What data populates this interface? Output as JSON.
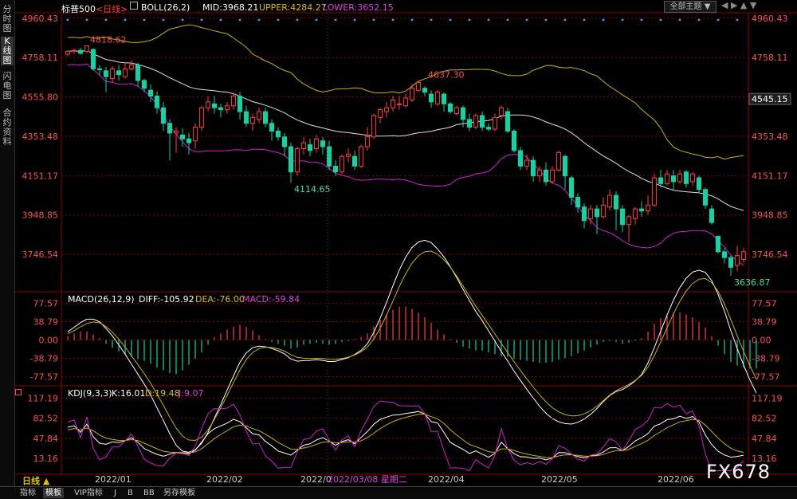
{
  "side_tabs": [
    "分时图",
    "K线图",
    "闪电图",
    "合约资料"
  ],
  "header": {
    "symbol": "标普500",
    "period": "<日线>",
    "boll_label": "BOLL(26,2)",
    "mid": "MID:3968.21",
    "upper": "UPPER:4284.27",
    "lower": "LOWER:3652.15",
    "theme_button": "全部主题 ▼"
  },
  "macd_header": {
    "label": "MACD(26,12,9)",
    "diff": "DIFF:-105.92",
    "dea": "DEA:-76.00",
    "macd": "MACD:-59.84"
  },
  "kdj_header": {
    "label": "KDJ(9,3,3)",
    "k": "K:16.01",
    "d": "D:19.48",
    "j": "J:9.07"
  },
  "bottom": {
    "period_label": "日线 ▲",
    "tabs": [
      "指标",
      "模板",
      "VIP指标",
      "J",
      "B",
      "BB",
      "另存模板"
    ],
    "active_tab": 1,
    "x_labels": [
      "2022/01",
      "2022/02",
      "2022/0",
      "2022/03/08 星期二",
      "2022/04",
      "2022/05",
      "2022/06"
    ]
  },
  "watermark": "FX678",
  "colors": {
    "up": "#ff4040",
    "down": "#18d0a0",
    "mid": "#e0e0e0",
    "upper": "#c8b400",
    "lower": "#d020d0",
    "grid": "#8a0000"
  },
  "chart_data": [
    {
      "type": "candlestick",
      "title": "标普500 <日线> BOLL(26,2)",
      "y_ticks": [
        4960.43,
        4758.11,
        4555.8,
        4353.48,
        4151.17,
        3948.85,
        3746.54
      ],
      "ylim": [
        3620,
        4980
      ],
      "last_price_tag": 4545.15,
      "annotations": [
        {
          "label": "4818.62",
          "value": 4818.62,
          "index": 3
        },
        {
          "label": "4637.30",
          "value": 4637.3,
          "index": 56
        },
        {
          "label": "4114.65",
          "value": 4114.65,
          "index": 35
        },
        {
          "label": "3636.87",
          "value": 3636.87,
          "index": 104
        }
      ],
      "candles": [
        [
          4775,
          4790,
          4765,
          4796
        ],
        [
          4792,
          4795,
          4778,
          4805
        ],
        [
          4795,
          4780,
          4772,
          4808
        ],
        [
          4790,
          4818,
          4780,
          4818
        ],
        [
          4800,
          4700,
          4690,
          4805
        ],
        [
          4700,
          4695,
          4670,
          4720
        ],
        [
          4690,
          4660,
          4580,
          4710
        ],
        [
          4650,
          4700,
          4630,
          4715
        ],
        [
          4690,
          4670,
          4640,
          4720
        ],
        [
          4660,
          4700,
          4650,
          4735
        ],
        [
          4700,
          4720,
          4690,
          4745
        ],
        [
          4720,
          4640,
          4610,
          4730
        ],
        [
          4640,
          4600,
          4580,
          4650
        ],
        [
          4590,
          4560,
          4530,
          4620
        ],
        [
          4560,
          4500,
          4470,
          4585
        ],
        [
          4500,
          4420,
          4380,
          4530
        ],
        [
          4420,
          4370,
          4230,
          4440
        ],
        [
          4370,
          4380,
          4270,
          4400
        ],
        [
          4360,
          4340,
          4300,
          4395
        ],
        [
          4340,
          4320,
          4260,
          4370
        ],
        [
          4330,
          4400,
          4290,
          4420
        ],
        [
          4400,
          4500,
          4380,
          4510
        ],
        [
          4500,
          4530,
          4480,
          4560
        ],
        [
          4520,
          4500,
          4470,
          4560
        ],
        [
          4500,
          4490,
          4450,
          4520
        ],
        [
          4490,
          4510,
          4470,
          4530
        ],
        [
          4510,
          4560,
          4490,
          4580
        ],
        [
          4560,
          4480,
          4440,
          4580
        ],
        [
          4480,
          4420,
          4400,
          4510
        ],
        [
          4420,
          4450,
          4380,
          4470
        ],
        [
          4440,
          4480,
          4420,
          4500
        ],
        [
          4480,
          4420,
          4400,
          4500
        ],
        [
          4420,
          4380,
          4330,
          4440
        ],
        [
          4380,
          4350,
          4330,
          4400
        ],
        [
          4350,
          4300,
          4250,
          4370
        ],
        [
          4300,
          4170,
          4114.65,
          4320
        ],
        [
          4170,
          4290,
          4150,
          4300
        ],
        [
          4290,
          4320,
          4260,
          4350
        ],
        [
          4310,
          4280,
          4250,
          4340
        ],
        [
          4290,
          4340,
          4270,
          4360
        ],
        [
          4330,
          4300,
          4260,
          4350
        ],
        [
          4300,
          4200,
          4180,
          4330
        ],
        [
          4200,
          4170,
          4150,
          4230
        ],
        [
          4170,
          4250,
          4160,
          4260
        ],
        [
          4250,
          4260,
          4220,
          4290
        ],
        [
          4250,
          4200,
          4180,
          4280
        ],
        [
          4200,
          4300,
          4190,
          4310
        ],
        [
          4300,
          4350,
          4280,
          4400
        ],
        [
          4350,
          4460,
          4340,
          4470
        ],
        [
          4450,
          4490,
          4420,
          4500
        ],
        [
          4480,
          4500,
          4450,
          4530
        ],
        [
          4500,
          4540,
          4480,
          4560
        ],
        [
          4520,
          4520,
          4490,
          4560
        ],
        [
          4510,
          4550,
          4500,
          4570
        ],
        [
          4540,
          4600,
          4530,
          4620
        ],
        [
          4590,
          4630,
          4580,
          4637.3
        ],
        [
          4600,
          4580,
          4560,
          4610
        ],
        [
          4570,
          4530,
          4500,
          4590
        ],
        [
          4520,
          4580,
          4510,
          4590
        ],
        [
          4570,
          4520,
          4480,
          4580
        ],
        [
          4520,
          4480,
          4470,
          4530
        ],
        [
          4470,
          4500,
          4460,
          4510
        ],
        [
          4500,
          4440,
          4400,
          4510
        ],
        [
          4440,
          4400,
          4380,
          4470
        ],
        [
          4400,
          4460,
          4390,
          4470
        ],
        [
          4460,
          4400,
          4380,
          4480
        ],
        [
          4400,
          4390,
          4380,
          4420
        ],
        [
          4390,
          4450,
          4380,
          4470
        ],
        [
          4460,
          4500,
          4440,
          4510
        ],
        [
          4480,
          4380,
          4370,
          4500
        ],
        [
          4380,
          4280,
          4270,
          4390
        ],
        [
          4280,
          4200,
          4180,
          4300
        ],
        [
          4200,
          4230,
          4180,
          4260
        ],
        [
          4230,
          4150,
          4120,
          4250
        ],
        [
          4150,
          4180,
          4120,
          4200
        ],
        [
          4180,
          4120,
          4100,
          4220
        ],
        [
          4120,
          4180,
          4110,
          4200
        ],
        [
          4180,
          4270,
          4170,
          4280
        ],
        [
          4250,
          4150,
          4080,
          4260
        ],
        [
          4140,
          4040,
          4000,
          4150
        ],
        [
          4040,
          3990,
          3960,
          4060
        ],
        [
          3990,
          3920,
          3880,
          4010
        ],
        [
          3930,
          3980,
          3900,
          4000
        ],
        [
          3980,
          3940,
          3850,
          4000
        ],
        [
          3940,
          4000,
          3930,
          4040
        ],
        [
          3990,
          4050,
          3970,
          4080
        ],
        [
          4050,
          3980,
          3870,
          4070
        ],
        [
          3980,
          3900,
          3860,
          4000
        ],
        [
          3900,
          3940,
          3810,
          3950
        ],
        [
          3930,
          3980,
          3900,
          3990
        ],
        [
          3980,
          3970,
          3940,
          4020
        ],
        [
          3970,
          4000,
          3950,
          4050
        ],
        [
          4000,
          4140,
          3990,
          4160
        ],
        [
          4140,
          4110,
          4090,
          4180
        ],
        [
          4110,
          4160,
          4100,
          4180
        ],
        [
          4150,
          4120,
          4080,
          4180
        ],
        [
          4120,
          4160,
          4110,
          4180
        ],
        [
          4170,
          4110,
          4090,
          4180
        ],
        [
          4120,
          4160,
          4100,
          4170
        ],
        [
          4140,
          4080,
          4060,
          4150
        ],
        [
          4080,
          4000,
          3980,
          4090
        ],
        [
          3980,
          3910,
          3900,
          4000
        ],
        [
          3840,
          3760,
          3750,
          3840
        ],
        [
          3760,
          3730,
          3700,
          3780
        ],
        [
          3730,
          3680,
          3636.87,
          3740
        ],
        [
          3690,
          3740,
          3660,
          3790
        ],
        [
          3720,
          3760,
          3700,
          3780
        ]
      ]
    },
    {
      "type": "macd",
      "title": "MACD(26,12,9)",
      "y_ticks": [
        77.57,
        38.79,
        0.0,
        -38.79,
        -77.57
      ],
      "ylim": [
        -100,
        95
      ],
      "histogram": [
        8,
        14,
        18,
        18,
        12,
        4,
        -8,
        -16,
        -24,
        -30,
        -36,
        -40,
        -44,
        -50,
        -58,
        -64,
        -70,
        -72,
        -64,
        -52,
        -40,
        -26,
        -10,
        6,
        14,
        22,
        28,
        32,
        28,
        20,
        10,
        2,
        -4,
        -8,
        -12,
        -18,
        -16,
        -10,
        -8,
        -6,
        -8,
        -10,
        -8,
        -4,
        -2,
        2,
        6,
        14,
        28,
        42,
        54,
        64,
        70,
        70,
        66,
        58,
        48,
        36,
        22,
        12,
        2,
        -6,
        -14,
        -18,
        -22,
        -22,
        -26,
        -30,
        -34,
        -36,
        -40,
        -42,
        -44,
        -46,
        -48,
        -48,
        -46,
        -42,
        -38,
        -34,
        -28,
        -22,
        -16,
        -10,
        -4,
        -2,
        -4,
        -8,
        -6,
        -2,
        4,
        18,
        34,
        46,
        54,
        58,
        58,
        54,
        48,
        38,
        26,
        8,
        -12,
        -30,
        -46,
        -54,
        -58,
        -60,
        -60
      ]
    },
    {
      "type": "kdj",
      "title": "KDJ(9,3,3)",
      "y_ticks": [
        117.19,
        82.52,
        47.84,
        13.16
      ],
      "ylim": [
        -10,
        130
      ]
    }
  ]
}
